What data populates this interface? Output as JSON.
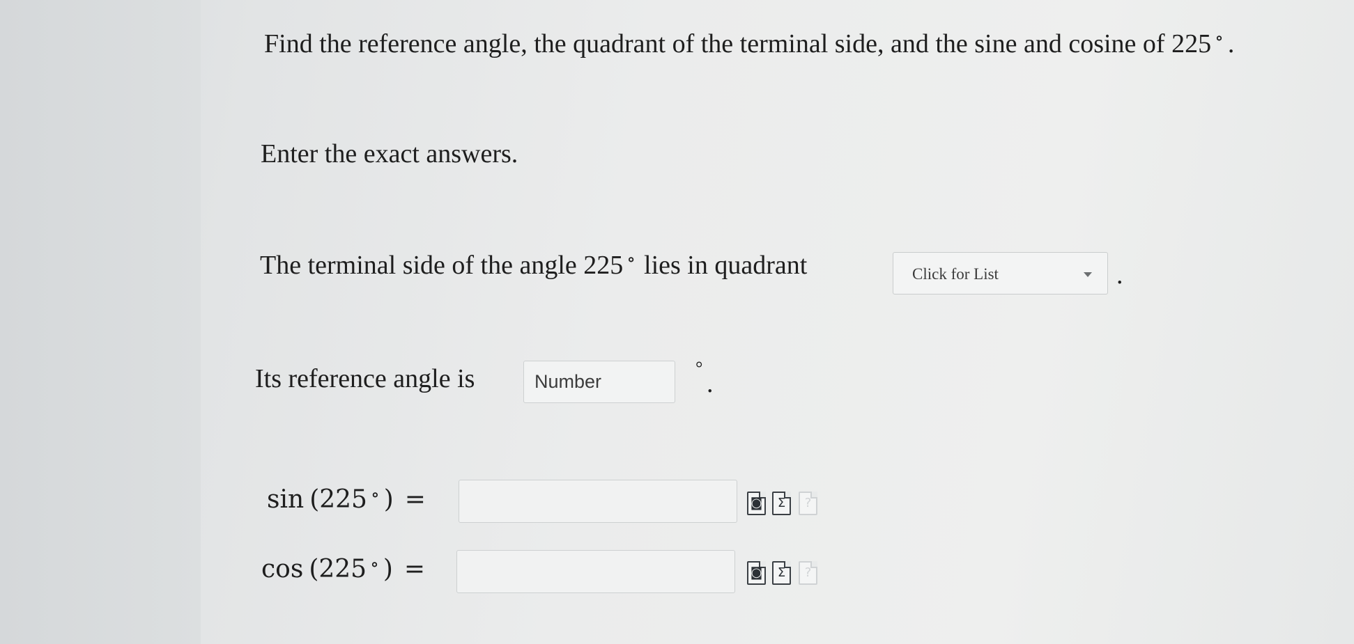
{
  "question": {
    "prompt": "Find the reference angle, the quadrant of the terminal side, and the sine and cosine of 225",
    "prompt_end": ".",
    "instruction": "Enter the exact answers."
  },
  "quadrant": {
    "text": "The terminal side of the angle 225",
    "text_after_degree": "lies in quadrant",
    "select_label": "Click for List",
    "end": "."
  },
  "reference": {
    "text": "Its reference angle is",
    "placeholder": "Number",
    "degree_symbol": "°",
    "end": "."
  },
  "sine": {
    "func": "sin",
    "angle": "(225",
    "close": ")",
    "equals": "="
  },
  "cosine": {
    "func": "cos",
    "angle": "(225",
    "close": ")",
    "equals": "="
  },
  "degree": "∘",
  "icons": [
    "preview-icon",
    "sigma-icon",
    "help-icon"
  ],
  "colors": {
    "background": "#eceded",
    "text": "#1e1e1e",
    "input_border": "#cdd0d1"
  }
}
